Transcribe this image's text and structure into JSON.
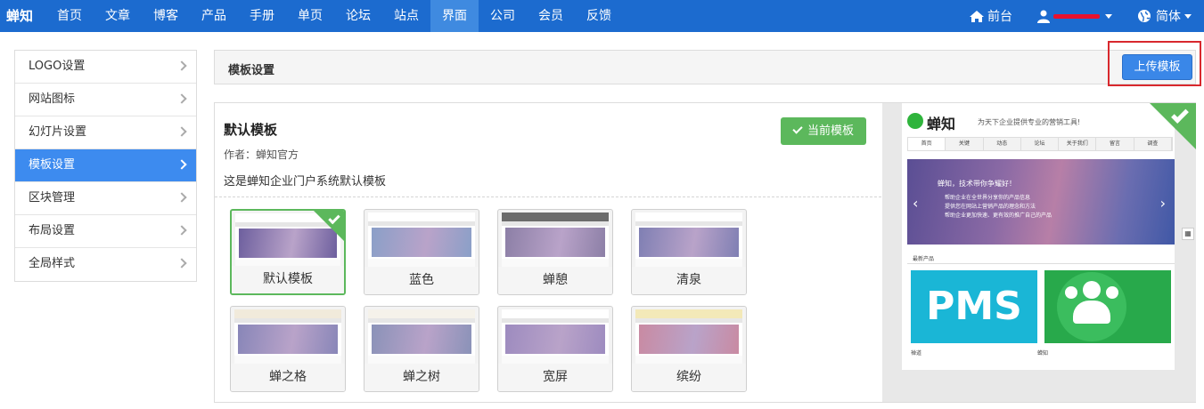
{
  "topnav": {
    "brand": "蝉知",
    "items": [
      "首页",
      "文章",
      "博客",
      "产品",
      "手册",
      "单页",
      "论坛",
      "站点",
      "界面",
      "公司",
      "会员",
      "反馈"
    ],
    "active_index": 8,
    "frontend_label": "前台",
    "language_label": "简体"
  },
  "sidebar": {
    "items": [
      "LOGO设置",
      "网站图标",
      "幻灯片设置",
      "模板设置",
      "区块管理",
      "布局设置",
      "全局样式"
    ],
    "active_index": 3
  },
  "panel": {
    "title": "模板设置",
    "upload_label": "上传模板"
  },
  "template": {
    "name": "默认模板",
    "author": "作者：蝉知官方",
    "description": "这是蝉知企业门户系统默认模板",
    "current_label": "当前模板"
  },
  "thumbnails": [
    {
      "label": "默认模板",
      "selected": true,
      "banner": "#6d5f9e",
      "header": "#ffffff"
    },
    {
      "label": "蓝色",
      "selected": false,
      "banner": "#8a9fc8",
      "header": "#ffffff"
    },
    {
      "label": "蝉憩",
      "selected": false,
      "banner": "#8c7fa6",
      "header": "#6b6b6b"
    },
    {
      "label": "清泉",
      "selected": false,
      "banner": "#7f7fb3",
      "header": "#ffffff"
    },
    {
      "label": "蝉之格",
      "selected": false,
      "banner": "#8886b8",
      "header": "#f1eadb"
    },
    {
      "label": "蝉之树",
      "selected": false,
      "banner": "#8a92b8",
      "header": "#f5f2ea"
    },
    {
      "label": "宽屏",
      "selected": false,
      "banner": "#9d8bbf",
      "header": "#ffffff"
    },
    {
      "label": "缤纷",
      "selected": false,
      "banner": "#c98aa2",
      "header": "#f3e9b8"
    }
  ],
  "preview": {
    "logo_text": "蝉知",
    "slogan": "为天下企业提供专业的营销工具!",
    "nav": [
      "首页",
      "关键",
      "动态",
      "论坛",
      "关于我们",
      "留言",
      "调查"
    ],
    "banner_title": "蝉知，技术带你争耀好！",
    "banner_lines": [
      "帮助企业在全世界分享你的产品信息",
      "提供您在网站上营销产品的理念和方法",
      "帮助企业更加快速、更有效的推广自己的产品"
    ],
    "section_title": "最新产品",
    "pms_text": "PMS",
    "product1": "禅道",
    "product2": "蝉知"
  },
  "colors": {
    "nav_bg": "#1c6bcf",
    "accent": "#3d8bef",
    "success": "#5cb85c",
    "highlight": "#d8282d"
  }
}
